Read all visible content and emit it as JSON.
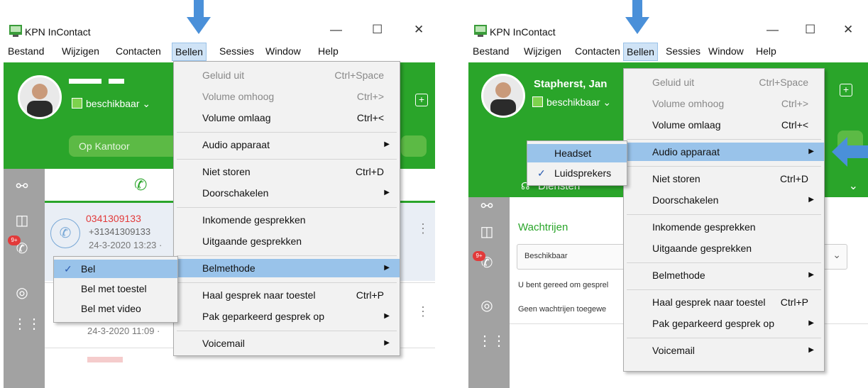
{
  "colors": {
    "green": "#2aa52a",
    "highlight": "#99c3ea",
    "sidebar": "#a2a2a2",
    "arrow": "#4a90d9"
  },
  "left": {
    "title": "KPN InContact",
    "controls": {
      "min": "—",
      "max": "☐",
      "close": "✕"
    },
    "menu": [
      "Bestand",
      "Wijzigen",
      "Contacten",
      "Bellen",
      "Sessies",
      "Window",
      "Help"
    ],
    "status": "beschikbaar",
    "location": "Op Kantoor",
    "calls": [
      {
        "number": "0341309133",
        "sub": "+31341309133",
        "time": "24-3-2020 13:23 ·"
      },
      {
        "time": "24-3-2020 11:09 ·"
      }
    ],
    "dropdown": [
      {
        "label": "Geluid uit",
        "shortcut": "Ctrl+Space",
        "disabled": true
      },
      {
        "label": "Volume omhoog",
        "shortcut": "Ctrl+>",
        "disabled": true
      },
      {
        "label": "Volume omlaag",
        "shortcut": "Ctrl+<"
      },
      {
        "label": "Audio apparaat"
      },
      {
        "label": "Niet storen",
        "shortcut": "Ctrl+D"
      },
      {
        "label": "Doorschakelen"
      },
      {
        "label": "Inkomende gesprekken"
      },
      {
        "label": "Uitgaande gesprekken"
      },
      {
        "label": "Belmethode"
      },
      {
        "label": "Haal gesprek naar toestel",
        "shortcut": "Ctrl+P"
      },
      {
        "label": "Pak geparkeerd gesprek op"
      },
      {
        "label": "Voicemail"
      }
    ],
    "submenu": [
      {
        "label": "Bel",
        "checked": true
      },
      {
        "label": "Bel met toestel"
      },
      {
        "label": "Bel met video"
      }
    ]
  },
  "right": {
    "title": "KPN InContact",
    "controls": {
      "min": "—",
      "max": "☐",
      "close": "✕"
    },
    "menu": [
      "Bestand",
      "Wijzigen",
      "Contacten",
      "Bellen",
      "Sessies",
      "Window",
      "Help"
    ],
    "user_name": "Stapherst, Jan",
    "status": "beschikbaar",
    "tab": "Diensten",
    "queue_title": "Wachtrijen",
    "queue_select": "Beschikbaar",
    "info1": "U bent gereed om gesprel",
    "info2": "Geen wachtrijen toegewe",
    "dropdown": [
      {
        "label": "Geluid uit",
        "shortcut": "Ctrl+Space",
        "disabled": true
      },
      {
        "label": "Volume omhoog",
        "shortcut": "Ctrl+>",
        "disabled": true
      },
      {
        "label": "Volume omlaag",
        "shortcut": "Ctrl+<"
      },
      {
        "label": "Audio apparaat"
      },
      {
        "label": "Niet storen",
        "shortcut": "Ctrl+D"
      },
      {
        "label": "Doorschakelen"
      },
      {
        "label": "Inkomende gesprekken"
      },
      {
        "label": "Uitgaande gesprekken"
      },
      {
        "label": "Belmethode"
      },
      {
        "label": "Haal gesprek naar toestel",
        "shortcut": "Ctrl+P"
      },
      {
        "label": "Pak geparkeerd gesprek op"
      },
      {
        "label": "Voicemail"
      }
    ],
    "submenu": [
      {
        "label": "Headset"
      },
      {
        "label": "Luidsprekers",
        "checked": true
      }
    ]
  }
}
